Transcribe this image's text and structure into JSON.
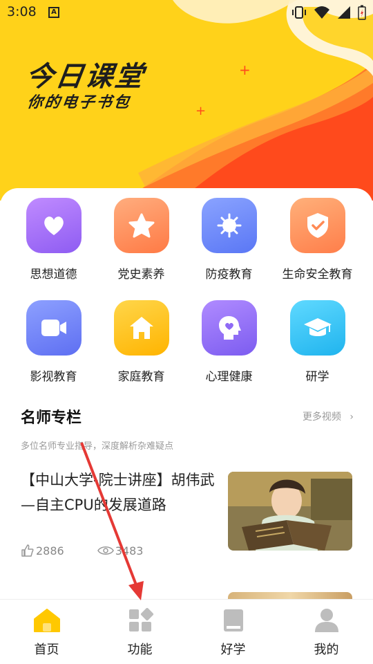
{
  "status_bar": {
    "time": "3:08",
    "app_icon_letter": "A"
  },
  "hero": {
    "title": "今日课堂",
    "subtitle": "你的电子书包"
  },
  "grid": [
    {
      "label": "思想道德",
      "icon": "heart-icon",
      "color": "#A874F8"
    },
    {
      "label": "党史素养",
      "icon": "star-icon",
      "color": "#FF8A5C"
    },
    {
      "label": "防疫教育",
      "icon": "virus-icon",
      "color": "#6E8CFF"
    },
    {
      "label": "生命安全教育",
      "icon": "shield-icon",
      "color": "#FF8F5A"
    },
    {
      "label": "影视教育",
      "icon": "video-camera-icon",
      "color": "#6F86FF"
    },
    {
      "label": "家庭教育",
      "icon": "house-icon",
      "color": "#FFC020"
    },
    {
      "label": "心理健康",
      "icon": "head-heart-icon",
      "color": "#9A72F7"
    },
    {
      "label": "研学",
      "icon": "graduation-cap-icon",
      "color": "#36C6F4"
    }
  ],
  "section": {
    "title": "名师专栏",
    "more": "更多视频",
    "subtitle": "多位名师专业指导，深度解析杂难疑点"
  },
  "article": {
    "title": "【中山大学-院士讲座】胡伟武—自主CPU的发展道路",
    "likes": "2886",
    "views": "3483"
  },
  "nav": [
    {
      "label": "首页",
      "icon": "home-icon",
      "active": true
    },
    {
      "label": "功能",
      "icon": "apps-icon",
      "active": false
    },
    {
      "label": "好学",
      "icon": "book-icon",
      "active": false
    },
    {
      "label": "我的",
      "icon": "person-icon",
      "active": false
    }
  ],
  "colors": {
    "brand_yellow": "#FFD21A",
    "accent_orange": "#FF5A1F",
    "arrow_red": "#E53935"
  }
}
